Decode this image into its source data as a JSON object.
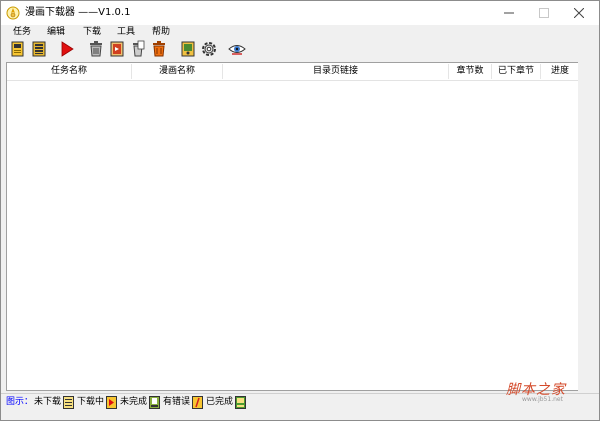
{
  "window": {
    "title": "漫画下载器    ——V1.0.1"
  },
  "menu": [
    "任务",
    "编辑",
    "下载",
    "工具",
    "帮助"
  ],
  "toolbar": {
    "buttons": [
      {
        "name": "new-task",
        "icon": "book-yellow-icon"
      },
      {
        "name": "task-list",
        "icon": "book-list-icon"
      },
      {
        "name": "start-download",
        "icon": "play-icon"
      },
      {
        "name": "delete",
        "icon": "trash-icon"
      },
      {
        "name": "import",
        "icon": "book-red-icon"
      },
      {
        "name": "clear",
        "icon": "trash-page-icon"
      },
      {
        "name": "delete-all",
        "icon": "trash-orange-icon"
      },
      {
        "name": "open-folder",
        "icon": "book-green-icon"
      },
      {
        "name": "settings",
        "icon": "gear-icon"
      },
      {
        "name": "view",
        "icon": "eye-icon"
      }
    ]
  },
  "table": {
    "columns": [
      "任务名称",
      "漫画名称",
      "目录页链接",
      "章节数",
      "已下章节",
      "进度"
    ],
    "rows": []
  },
  "statusbar": {
    "legend_label": "图示：",
    "items": [
      "未下载",
      "下载中",
      "未完成",
      "有错误",
      "已完成"
    ]
  },
  "watermark": {
    "text": "脚本之家",
    "url": "www.jb51.net"
  },
  "colors": {
    "legend_label": "#0000ff",
    "watermark": "#d44a2a",
    "play": "#e01010"
  }
}
